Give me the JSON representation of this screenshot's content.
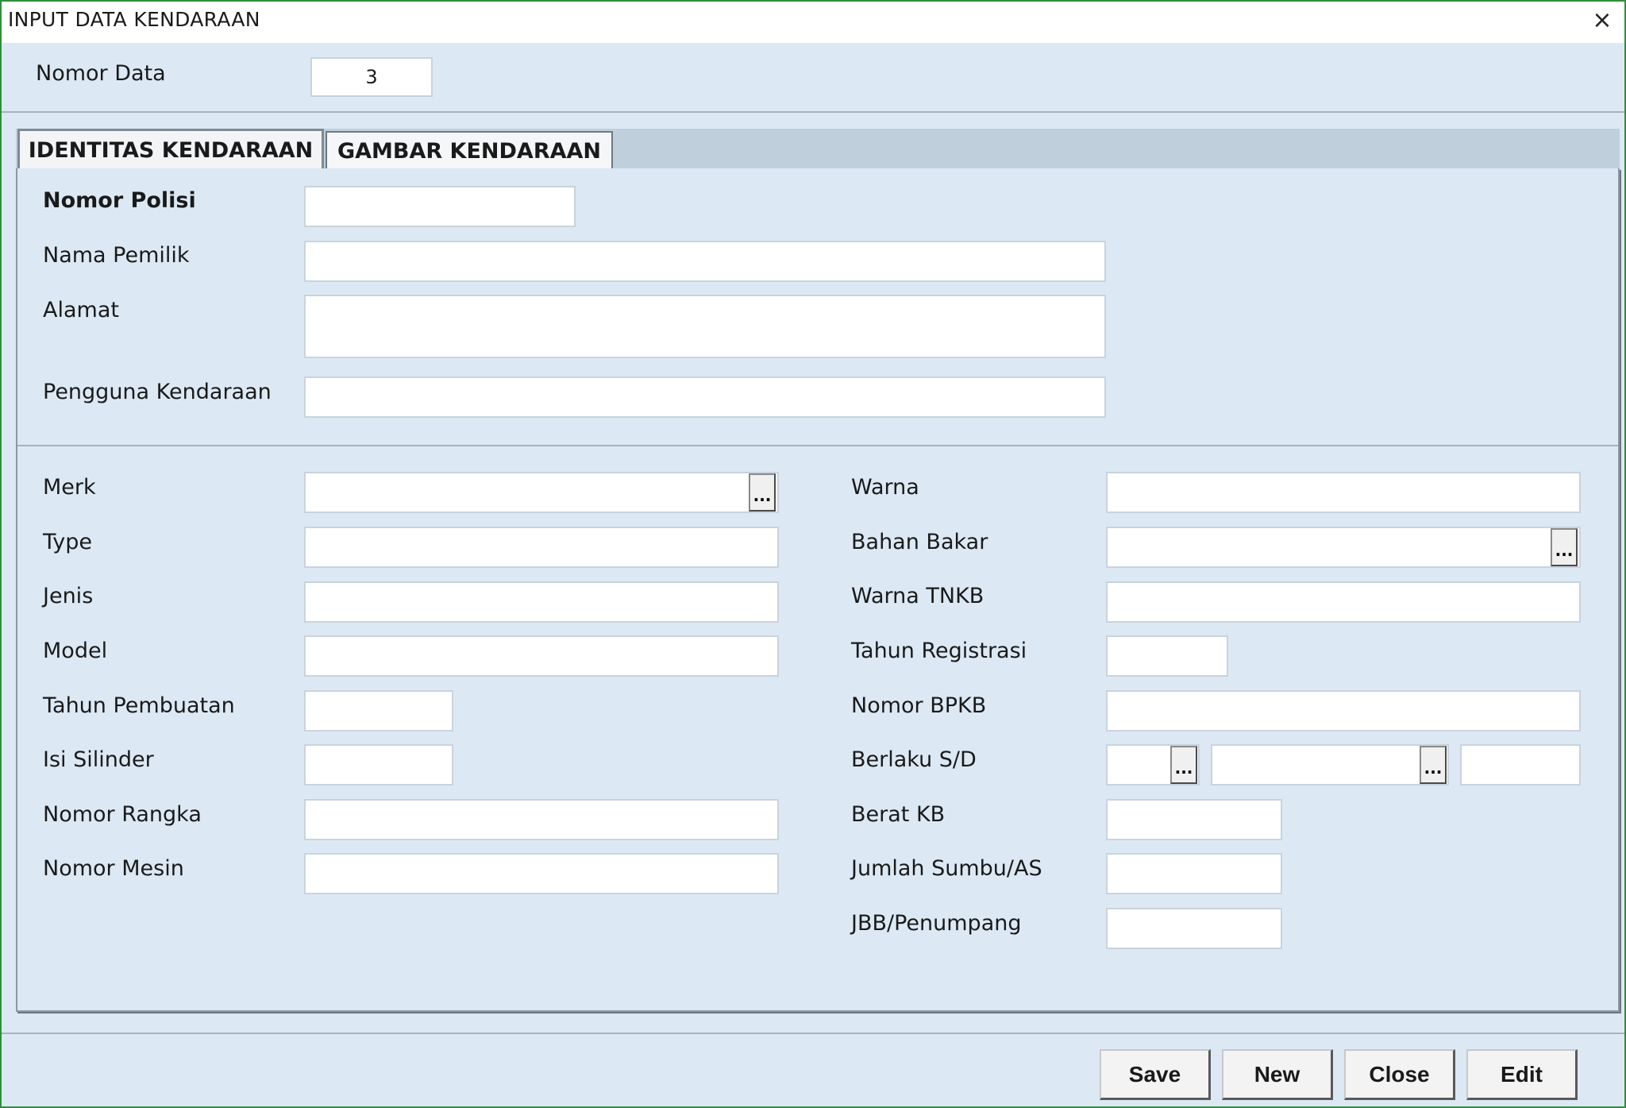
{
  "window": {
    "title": "INPUT DATA KENDARAAN"
  },
  "header": {
    "nomor_data_label": "Nomor Data",
    "nomor_data_value": "3"
  },
  "tabs": {
    "identitas": "IDENTITAS KENDARAAN",
    "gambar": "GAMBAR KENDARAAN"
  },
  "identitas": {
    "nomor_polisi": "Nomor Polisi",
    "nama_pemilik": "Nama Pemilik",
    "alamat": "Alamat",
    "pengguna": "Pengguna Kendaraan"
  },
  "left": {
    "merk": "Merk",
    "type": "Type",
    "jenis": "Jenis",
    "model": "Model",
    "tahun_pembuatan": "Tahun Pembuatan",
    "isi_silinder": "Isi Silinder",
    "nomor_rangka": "Nomor Rangka",
    "nomor_mesin": "Nomor Mesin"
  },
  "right": {
    "warna": "Warna",
    "bahan_bakar": "Bahan Bakar",
    "warna_tnkb": "Warna TNKB",
    "tahun_registrasi": "Tahun Registrasi",
    "nomor_bpkb": "Nomor BPKB",
    "berlaku_sd": "Berlaku S/D",
    "berat_kb": "Berat KB",
    "jumlah_sumbu": "Jumlah Sumbu/AS",
    "jbb_penumpang": "JBB/Penumpang"
  },
  "picker_glyph": "...",
  "close_glyph": "×",
  "buttons": {
    "save": "Save",
    "new": "New",
    "close": "Close",
    "edit": "Edit"
  }
}
